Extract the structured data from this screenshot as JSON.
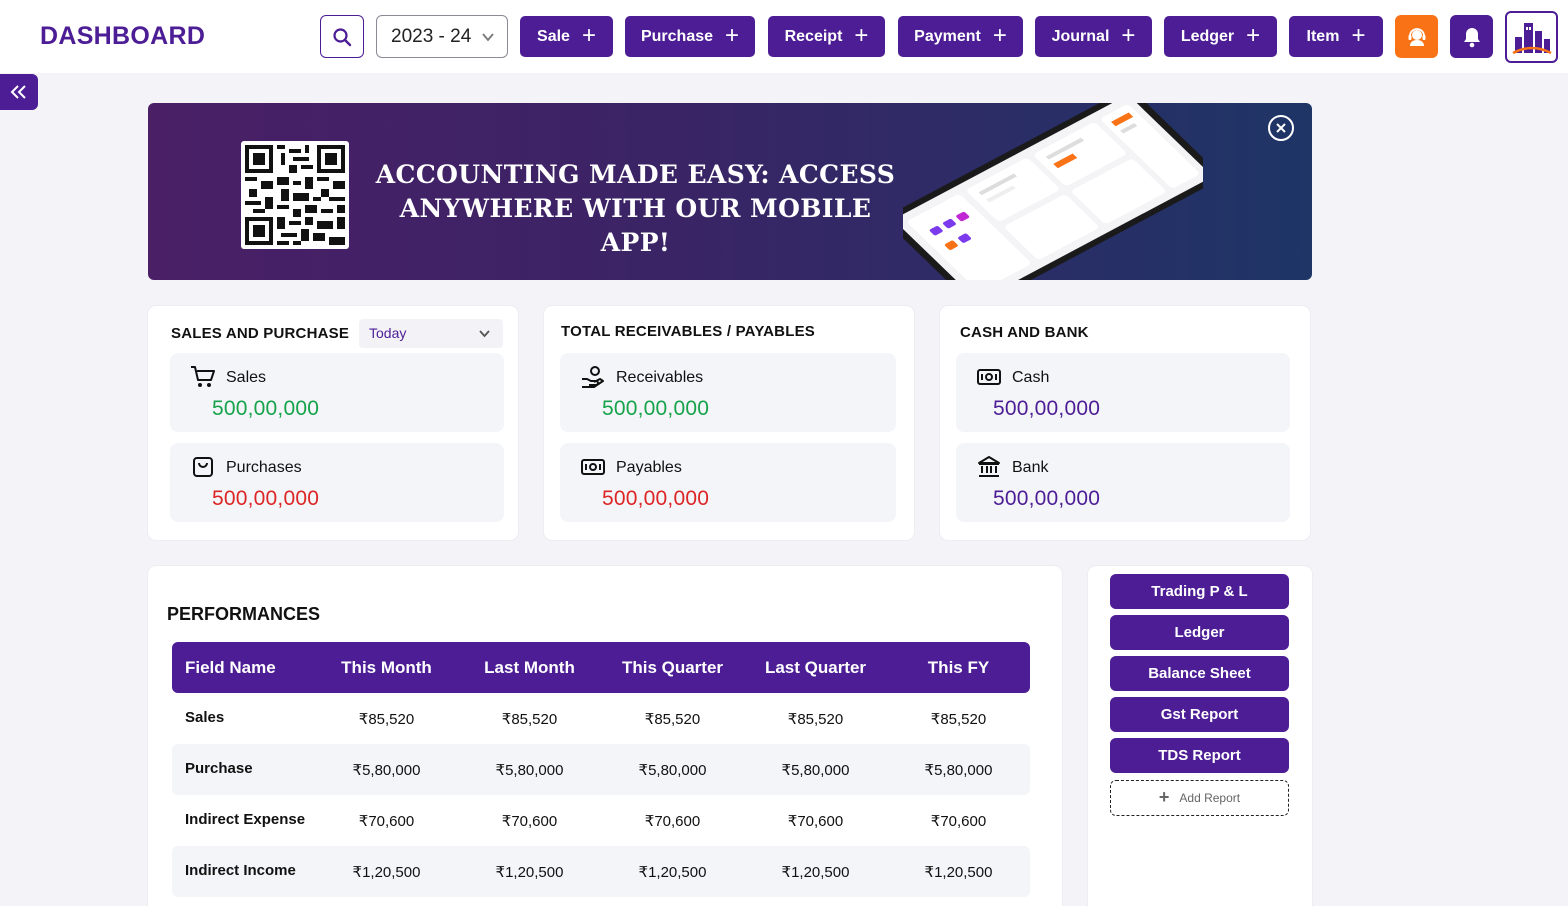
{
  "header": {
    "title": "DASHBOARD",
    "year": "2023 - 24",
    "quick_actions": [
      {
        "label": "Sale"
      },
      {
        "label": "Purchase"
      },
      {
        "label": "Receipt"
      },
      {
        "label": "Payment"
      },
      {
        "label": "Journal"
      },
      {
        "label": "Ledger"
      },
      {
        "label": "Item"
      }
    ],
    "colors": {
      "brand": "#4c1d95",
      "support": "#f97316"
    }
  },
  "banner": {
    "line1": "ACCOUNTING MADE EASY: ACCESS",
    "line2": "ANYWHERE WITH OUR MOBILE APP!"
  },
  "sales_purchase": {
    "title": "SALES AND PURCHASE",
    "filter": "Today",
    "sales_label": "Sales",
    "sales_value": "500,00,000",
    "purchases_label": "Purchases",
    "purchases_value": "500,00,000"
  },
  "receivables_payables": {
    "title": "TOTAL RECEIVABLES / PAYABLES",
    "receivables_label": "Receivables",
    "receivables_value": "500,00,000",
    "payables_label": "Payables",
    "payables_value": "500,00,000"
  },
  "cash_bank": {
    "title": "CASH AND BANK",
    "cash_label": "Cash",
    "cash_value": "500,00,000",
    "bank_label": "Bank",
    "bank_value": "500,00,000"
  },
  "value_colors": {
    "positive": "#16a34a",
    "negative": "#dc2626",
    "neutral": "#4c1d95"
  },
  "performances": {
    "title": "PERFORMANCES",
    "columns": [
      "Field Name",
      "This Month",
      "Last Month",
      "This Quarter",
      "Last Quarter",
      "This FY"
    ],
    "rows": [
      [
        "Sales",
        "₹85,520",
        "₹85,520",
        "₹85,520",
        "₹85,520",
        "₹85,520"
      ],
      [
        "Purchase",
        "₹5,80,000",
        "₹5,80,000",
        "₹5,80,000",
        "₹5,80,000",
        "₹5,80,000"
      ],
      [
        "Indirect Expense",
        "₹70,600",
        "₹70,600",
        "₹70,600",
        "₹70,600",
        "₹70,600"
      ],
      [
        "Indirect Income",
        "₹1,20,500",
        "₹1,20,500",
        "₹1,20,500",
        "₹1,20,500",
        "₹1,20,500"
      ]
    ]
  },
  "reports": {
    "items": [
      "Trading P & L",
      "Ledger",
      "Balance Sheet",
      "Gst Report",
      "TDS Report"
    ],
    "add_label": "Add Report"
  }
}
